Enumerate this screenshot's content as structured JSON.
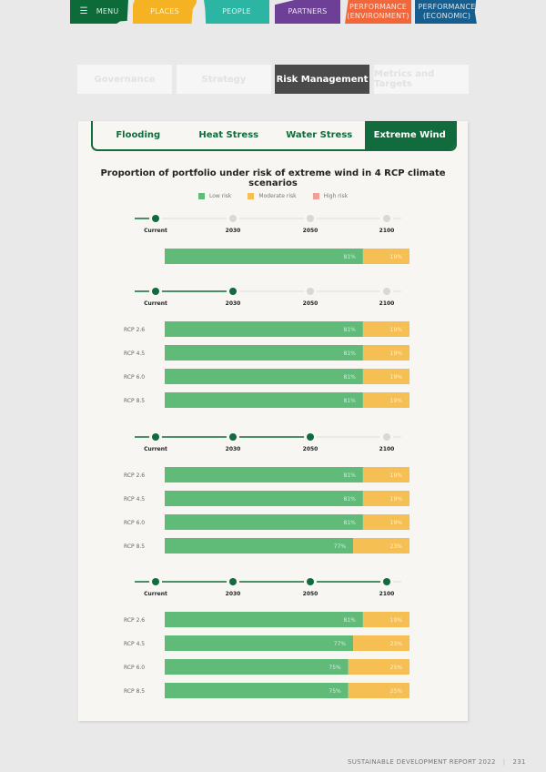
{
  "nav": {
    "menu": "MENU",
    "menu_icon": "hamburger-icon",
    "places": "PLACES",
    "people": "PEOPLE",
    "partners": "PARTNERS",
    "performance_env_1": "PERFORMANCE",
    "performance_env_2": "(ENVIRONMENT)",
    "performance_econ_1": "PERFORMANCE",
    "performance_econ_2": "(ECONOMIC)"
  },
  "section_tabs": [
    {
      "label": "Governance",
      "active": false
    },
    {
      "label": "Strategy",
      "active": false
    },
    {
      "label": "Risk Management",
      "active": true
    },
    {
      "label": "Metrics and Targets",
      "active": false
    }
  ],
  "risk_tabs": [
    {
      "label": "Flooding",
      "active": false
    },
    {
      "label": "Heat Stress",
      "active": false
    },
    {
      "label": "Water Stress",
      "active": false
    },
    {
      "label": "Extreme Wind",
      "active": true
    }
  ],
  "colors": {
    "low": "#5fbb77",
    "moderate": "#f6bf54",
    "high": "#f0a095",
    "accent": "#126b3c",
    "inactive": "#d8d8d8"
  },
  "chart_data": {
    "type": "bar",
    "orientation": "horizontal-stacked",
    "title": "Proportion of portfolio under risk of extreme wind in 4 RCP climate scenarios",
    "legend": [
      "Low risk",
      "Moderate risk",
      "High risk"
    ],
    "legend_position": "top",
    "timeline_labels": [
      "Current",
      "2030",
      "2050",
      "2100"
    ],
    "groups": [
      {
        "period": "Current",
        "active_index": 0,
        "rows": [
          {
            "label": "",
            "low": 81,
            "moderate": 19,
            "high": 0
          }
        ]
      },
      {
        "period": "2030",
        "active_index": 1,
        "rows": [
          {
            "label": "RCP 2.6",
            "low": 81,
            "moderate": 19,
            "high": 0
          },
          {
            "label": "RCP 4.5",
            "low": 81,
            "moderate": 19,
            "high": 0
          },
          {
            "label": "RCP 6.0",
            "low": 81,
            "moderate": 19,
            "high": 0
          },
          {
            "label": "RCP 8.5",
            "low": 81,
            "moderate": 19,
            "high": 0
          }
        ]
      },
      {
        "period": "2050",
        "active_index": 2,
        "rows": [
          {
            "label": "RCP 2.6",
            "low": 81,
            "moderate": 19,
            "high": 0
          },
          {
            "label": "RCP 4.5",
            "low": 81,
            "moderate": 19,
            "high": 0
          },
          {
            "label": "RCP 6.0",
            "low": 81,
            "moderate": 19,
            "high": 0
          },
          {
            "label": "RCP 8.5",
            "low": 77,
            "moderate": 23,
            "high": 0
          }
        ]
      },
      {
        "period": "2100",
        "active_index": 3,
        "rows": [
          {
            "label": "RCP 2.6",
            "low": 81,
            "moderate": 19,
            "high": 0
          },
          {
            "label": "RCP 4.5",
            "low": 77,
            "moderate": 23,
            "high": 0
          },
          {
            "label": "RCP 6.0",
            "low": 75,
            "moderate": 25,
            "high": 0
          },
          {
            "label": "RCP 8.5",
            "low": 75,
            "moderate": 25,
            "high": 0
          }
        ]
      }
    ],
    "xlim": [
      0,
      100
    ],
    "unit": "%"
  },
  "footer": {
    "report": "SUSTAINABLE DEVELOPMENT REPORT 2022",
    "separator": "|",
    "page": "231"
  }
}
